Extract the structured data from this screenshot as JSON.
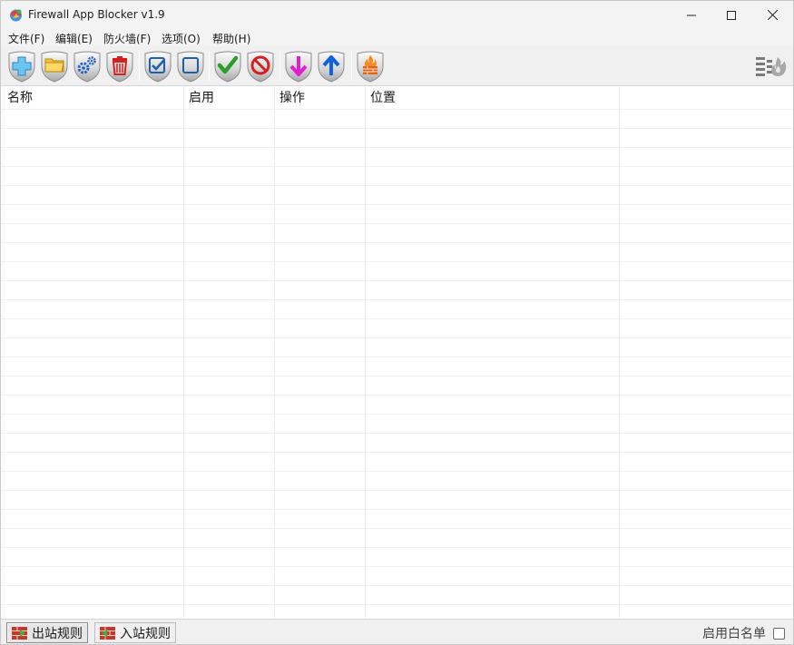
{
  "window": {
    "title": "Firewall App Blocker v1.9"
  },
  "menu": [
    {
      "label": "文件(F)"
    },
    {
      "label": "编辑(E)"
    },
    {
      "label": "防火墙(F)"
    },
    {
      "label": "选项(O)"
    },
    {
      "label": "帮助(H)"
    }
  ],
  "toolbar": {
    "buttons": [
      "add-icon",
      "folder-icon",
      "settings-gears-icon",
      "trash-icon",
      "check-square-icon",
      "uncheck-square-icon",
      "allow-check-icon",
      "block-icon",
      "arrow-down-icon",
      "arrow-up-icon",
      "firewall-icon"
    ],
    "right_icon": "firewall-settings-icon"
  },
  "list": {
    "columns": [
      "名称",
      "启用",
      "操作",
      "位置"
    ],
    "rows": []
  },
  "statusbar": {
    "tabs": [
      {
        "label": "出站规则",
        "active": true
      },
      {
        "label": "入站规则",
        "active": false
      }
    ],
    "whitelist_label": "启用白名单",
    "whitelist_checked": false
  },
  "colors": {
    "accent_blue": "#1e6fd9",
    "allow_green": "#2a9d2a",
    "block_red": "#d42020",
    "arrow_down_magenta": "#e020d0",
    "arrow_up_blue": "#1060e0"
  }
}
